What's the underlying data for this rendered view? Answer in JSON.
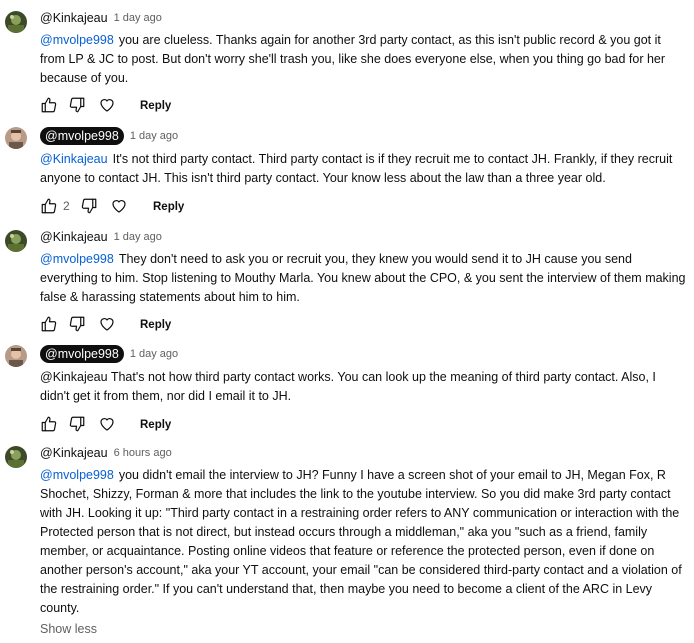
{
  "comments": [
    {
      "author": "@Kinkajeau",
      "time": "1 day ago",
      "mention": "@mvolpe998",
      "text": "you are clueless. Thanks again for another 3rd party contact, as this isn't public record & you got it from LP & JC to post. But don't worry she'll trash you, like she does everyone else, when you thing go bad for her because of you.",
      "likes": "",
      "reply_label": "Reply"
    },
    {
      "author": "@mvolpe998",
      "time": "1 day ago",
      "mention": "@Kinkajeau",
      "text": "It's not third party contact. Third party contact is if they recruit me to contact JH. Frankly, if they recruit anyone to contact JH. This isn't third party contact. Your know less about the law than a three year old.",
      "likes": "2",
      "reply_label": "Reply"
    },
    {
      "author": "@Kinkajeau",
      "time": "1 day ago",
      "mention": "@mvolpe998",
      "text": "They don't need to ask you or recruit you, they knew you would send it to JH cause you send everything to him. Stop listening to Mouthy Marla. You knew about the CPO, & you sent the interview of them making false & harassing statements about him to him.",
      "likes": "",
      "reply_label": "Reply"
    },
    {
      "author": "@mvolpe998",
      "time": "1 day ago",
      "mention": "",
      "text": "@Kinkajeau That's not how third party contact works. You can look up the meaning of third party contact. Also, I didn't get it from them, nor did I email it to JH.",
      "likes": "",
      "reply_label": "Reply"
    },
    {
      "author": "@Kinkajeau",
      "time": "6 hours ago",
      "mention": "@mvolpe998",
      "text": "you didn't email the interview to JH?  Funny I have a screen shot of your email to JH, Megan Fox, R Shochet, Shizzy, Forman & more that includes the link to the youtube interview. So you did make 3rd party contact with JH. Looking it up: \"Third party contact in a restraining order refers to ANY communication or interaction with the Protected person that is not direct, but instead occurs through a middleman,\" aka you \"such as a friend, family member, or acquaintance. Posting online videos that feature or reference the protected person, even if done on another person's account,\" aka your YT account, your email \"can be considered third-party contact and a violation of the restraining order.\" If you can't understand that, then maybe you need to become a client of the ARC in Levy county.",
      "show_less": "Show less"
    }
  ],
  "icons": {
    "like": "thumbs-up-icon",
    "dislike": "thumbs-down-icon",
    "heart": "heart-icon"
  },
  "colors": {
    "mention": "#065fd4",
    "meta": "#606060",
    "owner_chip": "#0f0f0f"
  }
}
